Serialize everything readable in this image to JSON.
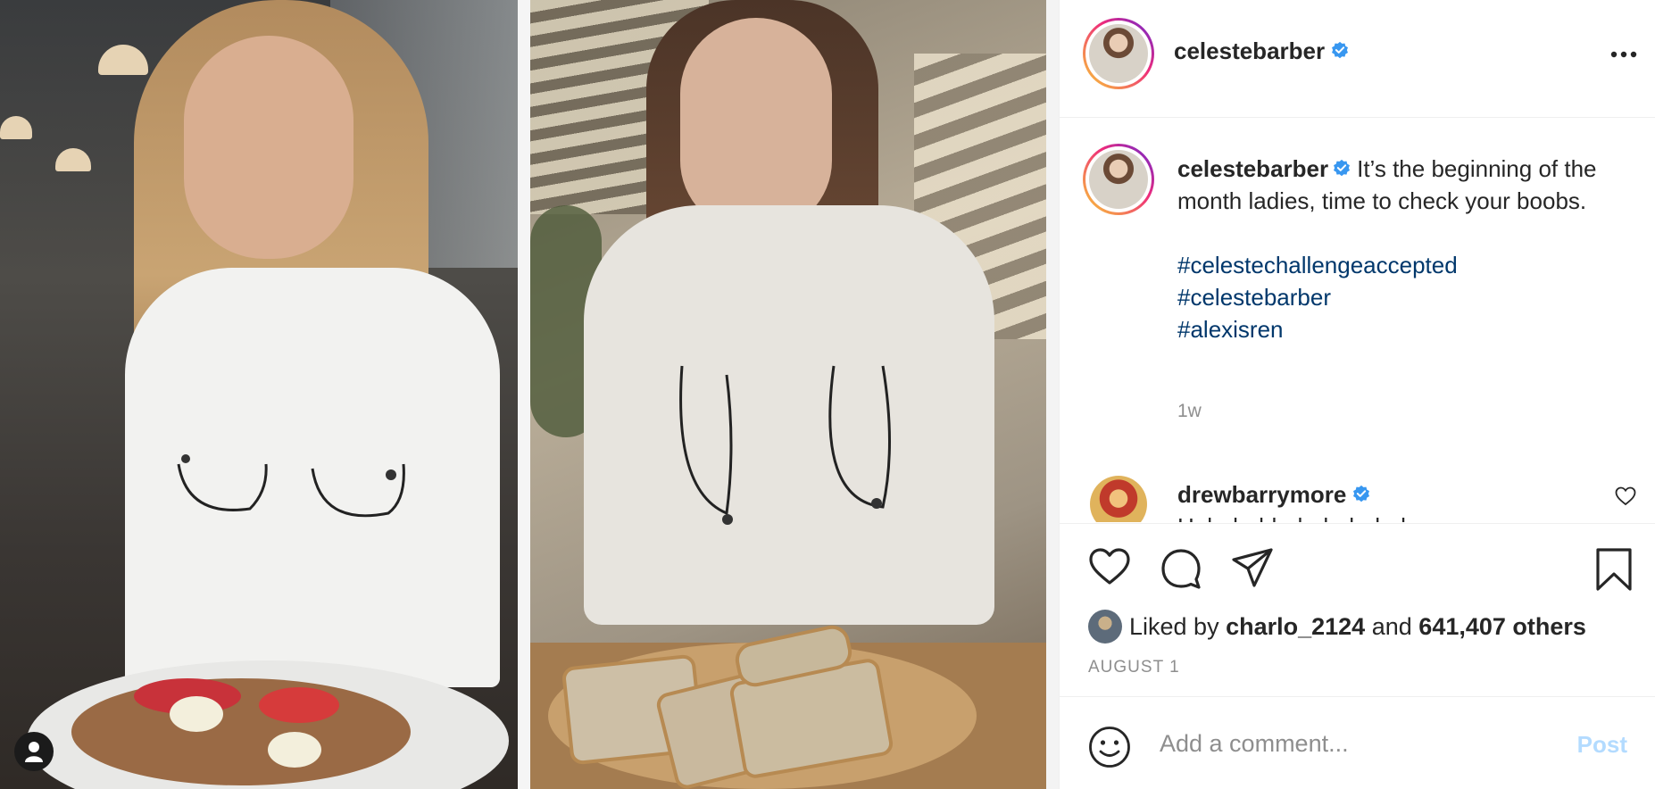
{
  "post": {
    "header": {
      "username": "celestebarber"
    },
    "caption": {
      "username": "celestebarber",
      "text": "It’s the beginning of the month ladies, time to check your boobs.",
      "hashtags": [
        "#celestechallengeaccepted",
        "#celestebarber",
        "#alexisren"
      ],
      "time": "1w"
    },
    "comment": {
      "username": "drewbarrymore",
      "text": "Hahahahhahahahahaha"
    },
    "likes": {
      "prefix": "Liked by",
      "user": "charlo_2124",
      "joiner": "and",
      "others": "641,407 others"
    },
    "date": "AUGUST 1",
    "comment_box": {
      "placeholder": "Add a comment...",
      "post_label": "Post"
    }
  },
  "colors": {
    "verified": "#3897f0",
    "hashtag": "#00376b",
    "secondary_text": "#8e8e8e",
    "post_button_disabled": "#b3dbff"
  },
  "icons": {
    "header_more": "more-horizontal-icon",
    "verified": "verified-badge-icon",
    "like": "heart-icon",
    "comment": "comment-bubble-icon",
    "share": "paper-plane-icon",
    "save": "bookmark-icon",
    "emoji": "smiley-icon",
    "user_tag": "user-icon"
  }
}
